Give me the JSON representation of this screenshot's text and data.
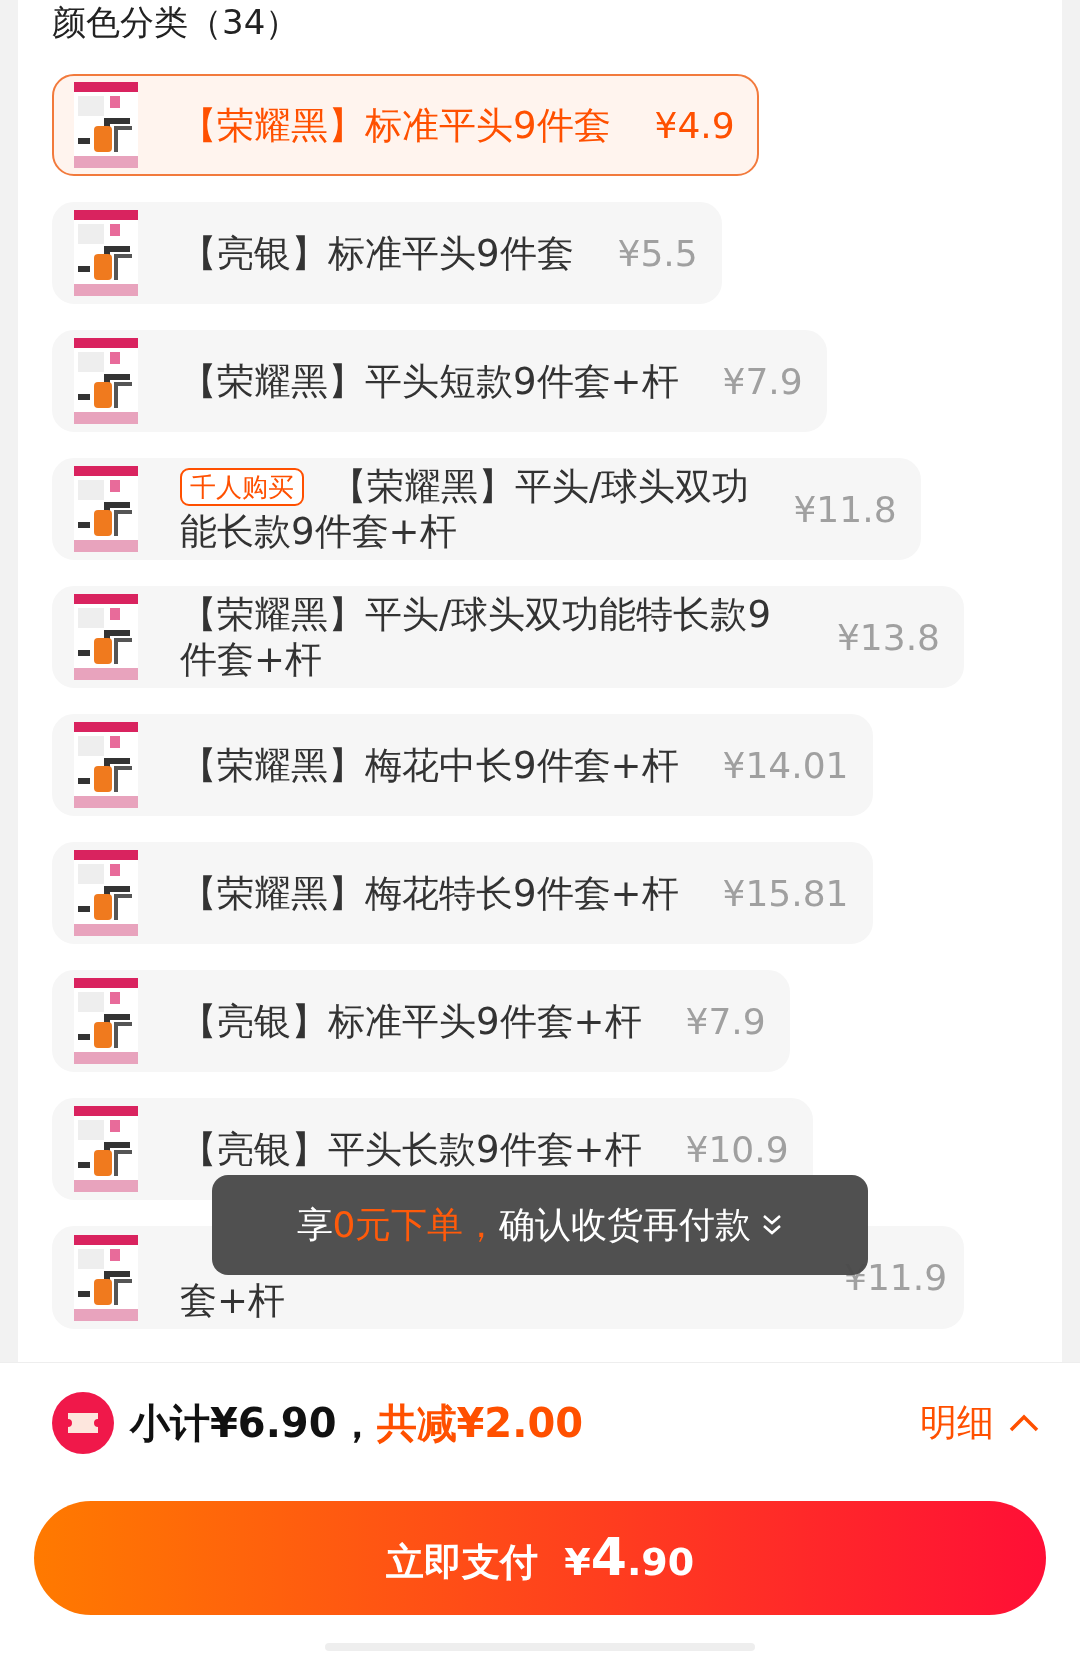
{
  "section": {
    "title": "颜色分类（34）"
  },
  "options": [
    {
      "label": "【荣耀黑】标准平头9件套",
      "price": "¥4.9",
      "selected": true
    },
    {
      "label": "【亮银】标准平头9件套",
      "price": "¥5.5",
      "selected": false
    },
    {
      "label": "【荣耀黑】平头短款9件套+杆",
      "price": "¥7.9",
      "selected": false
    },
    {
      "badge": "千人购买",
      "label_lines": [
        "【荣耀黑】平头/球头双功",
        "能长款9件套+杆"
      ],
      "price": "¥11.8",
      "selected": false
    },
    {
      "label": "【荣耀黑】平头/球头双功能特长款9件套+杆",
      "price": "¥13.8",
      "selected": false
    },
    {
      "label": "【荣耀黑】梅花中长9件套+杆",
      "price": "¥14.01",
      "selected": false
    },
    {
      "label": "【荣耀黑】梅花特长9件套+杆",
      "price": "¥15.81",
      "selected": false
    },
    {
      "label": "【亮银】标准平头9件套+杆",
      "price": "¥7.9",
      "selected": false
    },
    {
      "label": "【亮银】平头长款9件套+杆",
      "price": "¥10.9",
      "selected": false
    },
    {
      "label": "套+杆",
      "under_toast": true,
      "price": "¥11.9",
      "selected": false
    }
  ],
  "toast": {
    "prefix": "享",
    "highlight": "0元下单，",
    "suffix": "确认收货再付款"
  },
  "summary": {
    "subtotal": "小计¥6.90，",
    "discount": "共减¥2.00",
    "details_button": "明细"
  },
  "pay_button": {
    "label": "立即支付",
    "currency": "¥",
    "integer": "4",
    "decimal": ".90"
  }
}
